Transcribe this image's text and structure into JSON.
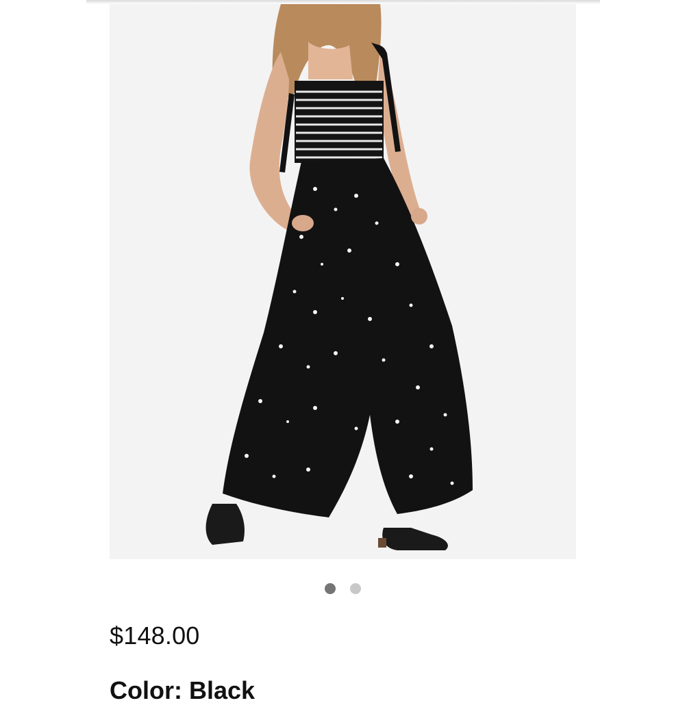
{
  "product": {
    "image_alt": "Black floral print wide-leg jumpsuit",
    "price": "$148.00",
    "name": "Color: Black"
  },
  "carousel": {
    "total": 2,
    "active_index": 0,
    "active_color": "#757575",
    "inactive_color": "#c8c8c8"
  },
  "colors": {
    "image_background": "#f3f3f3",
    "garment": "#121212",
    "text": "#111111"
  }
}
